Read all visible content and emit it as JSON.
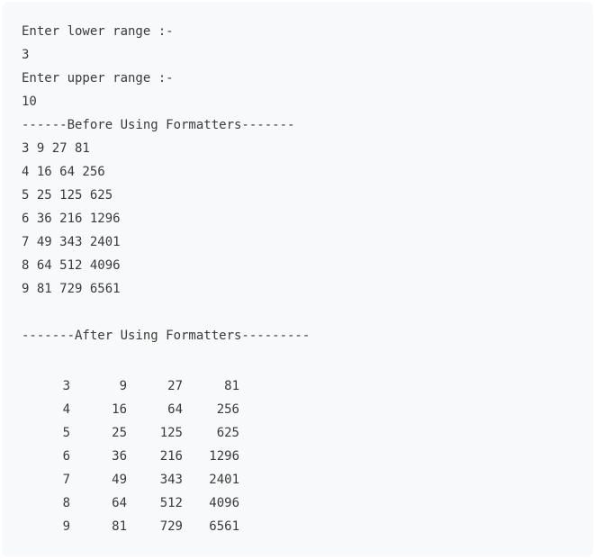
{
  "output": {
    "prompt_lower": "Enter lower range :-",
    "lower_value": "3",
    "prompt_upper": "Enter upper range :-",
    "upper_value": "10",
    "before_header": "------Before Using Formatters-------",
    "before_rows": [
      "3 9 27 81",
      "4 16 64 256",
      "5 25 125 625",
      "6 36 216 1296",
      "7 49 343 2401",
      "8 64 512 4096",
      "9 81 729 6561"
    ],
    "after_header": "-------After Using Formatters---------",
    "after_rows": [
      [
        "3",
        "9",
        "27",
        "81"
      ],
      [
        "4",
        "16",
        "64",
        "256"
      ],
      [
        "5",
        "25",
        "125",
        "625"
      ],
      [
        "6",
        "36",
        "216",
        "1296"
      ],
      [
        "7",
        "49",
        "343",
        "2401"
      ],
      [
        "8",
        "64",
        "512",
        "4096"
      ],
      [
        "9",
        "81",
        "729",
        "6561"
      ]
    ]
  }
}
